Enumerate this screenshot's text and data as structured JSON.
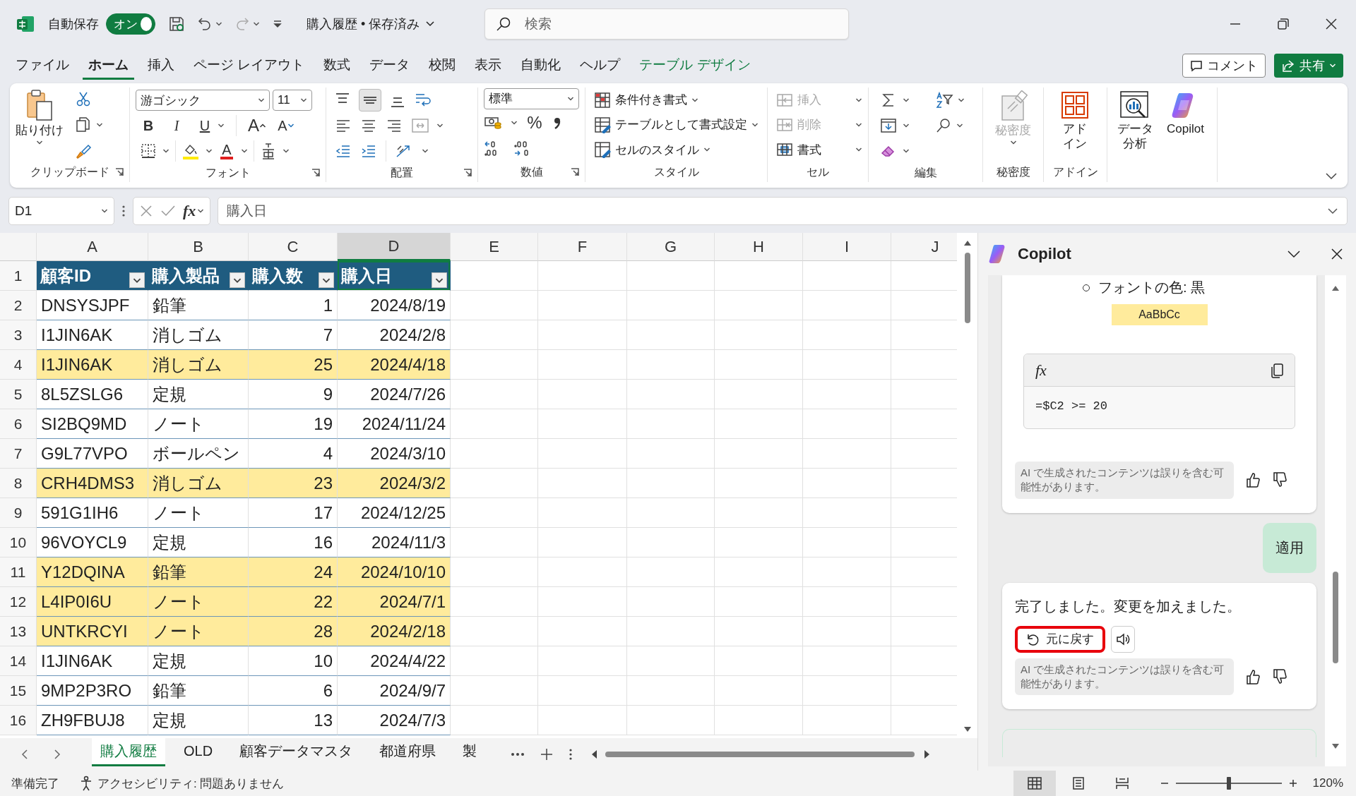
{
  "title_bar": {
    "autosave_label": "自動保存",
    "autosave": {
      "label": "オン",
      "on": true
    },
    "document_title": "購入履歴 • 保存済み",
    "search": {
      "placeholder": "検索"
    }
  },
  "ribbon_tabs": [
    {
      "label": "ファイル",
      "selected": false,
      "kind": "normal"
    },
    {
      "label": "ホーム",
      "selected": true,
      "kind": "normal"
    },
    {
      "label": "挿入",
      "selected": false,
      "kind": "normal"
    },
    {
      "label": "ページ レイアウト",
      "selected": false,
      "kind": "normal"
    },
    {
      "label": "数式",
      "selected": false,
      "kind": "normal"
    },
    {
      "label": "データ",
      "selected": false,
      "kind": "normal"
    },
    {
      "label": "校閲",
      "selected": false,
      "kind": "normal"
    },
    {
      "label": "表示",
      "selected": false,
      "kind": "normal"
    },
    {
      "label": "自動化",
      "selected": false,
      "kind": "normal"
    },
    {
      "label": "ヘルプ",
      "selected": false,
      "kind": "normal"
    },
    {
      "label": "テーブル デザイン",
      "selected": false,
      "kind": "contextual"
    }
  ],
  "header_buttons": {
    "comment": "コメント",
    "share": "共有"
  },
  "ribbon": {
    "clipboard": {
      "paste": "貼り付け",
      "label": "クリップボード"
    },
    "font": {
      "font_name": "游ゴシック",
      "font_size": "11",
      "bold": "B",
      "italic": "I",
      "underline": "U",
      "grow": "A",
      "shrink": "A",
      "font_color": "A",
      "label": "フォント"
    },
    "alignment": {
      "label": "配置",
      "vertical_align": [
        {
          "kind": "top",
          "selected": false
        },
        {
          "kind": "middle",
          "selected": true
        },
        {
          "kind": "bottom",
          "selected": false
        }
      ]
    },
    "number": {
      "format": "標準",
      "percent": "%",
      "label": "数値"
    },
    "styles": {
      "items": [
        {
          "kind": "conditional",
          "label": "条件付き書式"
        },
        {
          "kind": "table",
          "label": "テーブルとして書式設定"
        },
        {
          "kind": "cell_style",
          "label": "セルのスタイル"
        }
      ],
      "label": "スタイル"
    },
    "cells": {
      "items": [
        {
          "kind": "insert",
          "label": "挿入",
          "disabled": true
        },
        {
          "kind": "delete",
          "label": "削除",
          "disabled": true
        },
        {
          "kind": "format",
          "label": "書式",
          "disabled": false
        }
      ],
      "label": "セル"
    },
    "editing": {
      "label": "編集"
    },
    "sensitivity": {
      "button": "秘密度",
      "disabled": true,
      "label": "秘密度"
    },
    "addins": {
      "button": "アドイン",
      "label": "アドイン"
    },
    "analysis": {
      "data_analysis": "データ分析",
      "copilot": "Copilot"
    }
  },
  "formula_bar": {
    "name_box": "D1",
    "fx": "fx",
    "formula": "購入日"
  },
  "sheet": {
    "columns": [
      {
        "label": "A",
        "selected": false
      },
      {
        "label": "B",
        "selected": false
      },
      {
        "label": "C",
        "selected": false
      },
      {
        "label": "D",
        "selected": true
      },
      {
        "label": "E",
        "selected": false
      },
      {
        "label": "F",
        "selected": false
      },
      {
        "label": "G",
        "selected": false
      },
      {
        "label": "H",
        "selected": false
      },
      {
        "label": "I",
        "selected": false
      },
      {
        "label": "J",
        "selected": false
      }
    ],
    "header": {
      "number": "1",
      "cells": [
        {
          "text": "顧客ID",
          "selected": false
        },
        {
          "text": "購入製品",
          "selected": false
        },
        {
          "text": "購入数",
          "selected": false
        },
        {
          "text": "購入日",
          "selected": true
        }
      ]
    },
    "rows": [
      {
        "number": "2",
        "cells": [
          "DNSYSJPF",
          "鉛筆",
          "1",
          "2024/8/19"
        ],
        "highlighted": false
      },
      {
        "number": "3",
        "cells": [
          "I1JIN6AK",
          "消しゴム",
          "7",
          "2024/2/8"
        ],
        "highlighted": false
      },
      {
        "number": "4",
        "cells": [
          "I1JIN6AK",
          "消しゴム",
          "25",
          "2024/4/18"
        ],
        "highlighted": true
      },
      {
        "number": "5",
        "cells": [
          "8L5ZSLG6",
          "定規",
          "9",
          "2024/7/26"
        ],
        "highlighted": false
      },
      {
        "number": "6",
        "cells": [
          "SI2BQ9MD",
          "ノート",
          "19",
          "2024/11/24"
        ],
        "highlighted": false
      },
      {
        "number": "7",
        "cells": [
          "G9L77VPO",
          "ボールペン",
          "4",
          "2024/3/10"
        ],
        "highlighted": false
      },
      {
        "number": "8",
        "cells": [
          "CRH4DMS3",
          "消しゴム",
          "23",
          "2024/3/2"
        ],
        "highlighted": true
      },
      {
        "number": "9",
        "cells": [
          "591G1IH6",
          "ノート",
          "17",
          "2024/12/25"
        ],
        "highlighted": false
      },
      {
        "number": "10",
        "cells": [
          "96VOYCL9",
          "定規",
          "16",
          "2024/11/3"
        ],
        "highlighted": false
      },
      {
        "number": "11",
        "cells": [
          "Y12DQINA",
          "鉛筆",
          "24",
          "2024/10/10"
        ],
        "highlighted": true
      },
      {
        "number": "12",
        "cells": [
          "L4IP0I6U",
          "ノート",
          "22",
          "2024/7/1"
        ],
        "highlighted": true
      },
      {
        "number": "13",
        "cells": [
          "UNTKRCYI",
          "ノート",
          "28",
          "2024/2/18"
        ],
        "highlighted": true
      },
      {
        "number": "14",
        "cells": [
          "I1JIN6AK",
          "定規",
          "10",
          "2024/4/22"
        ],
        "highlighted": false
      },
      {
        "number": "15",
        "cells": [
          "9MP2P3RO",
          "鉛筆",
          "6",
          "2024/9/7"
        ],
        "highlighted": false
      },
      {
        "number": "16",
        "cells": [
          "ZH9FBUJ8",
          "定規",
          "13",
          "2024/7/3"
        ],
        "highlighted": false
      }
    ]
  },
  "sheet_tabs": [
    {
      "label": "購入履歴",
      "selected": true
    },
    {
      "label": "OLD",
      "selected": false
    },
    {
      "label": "顧客データマスタ",
      "selected": false
    },
    {
      "label": "都道府県",
      "selected": false
    },
    {
      "label": "製",
      "selected": false
    }
  ],
  "copilot": {
    "title": "Copilot",
    "messages": [
      {
        "kind": "assistant",
        "bullets": [
          "フォントの色: 黒"
        ],
        "sample": "AaBbCc",
        "code": {
          "label": "fx",
          "text": "=$C2 >= 20"
        },
        "disclaimer": "AI で生成されたコンテンツは誤りを含む可能性があります。"
      },
      {
        "kind": "user",
        "text": "適用"
      },
      {
        "kind": "assistant",
        "text": "完了しました。変更を加えました。",
        "undo": {
          "label": "元に戻す",
          "highlighted": true
        },
        "disclaimer": "AI で生成されたコンテンツは誤りを含む可能性があります。"
      }
    ]
  },
  "status_bar": {
    "ready": "準備完了",
    "accessibility": "アクセシビリティ: 問題ありません",
    "views": [
      {
        "kind": "normal",
        "selected": true
      },
      {
        "kind": "page_layout",
        "selected": false
      },
      {
        "kind": "page_break",
        "selected": false
      }
    ],
    "zoom": {
      "level": 0.5,
      "label": "120%"
    }
  }
}
